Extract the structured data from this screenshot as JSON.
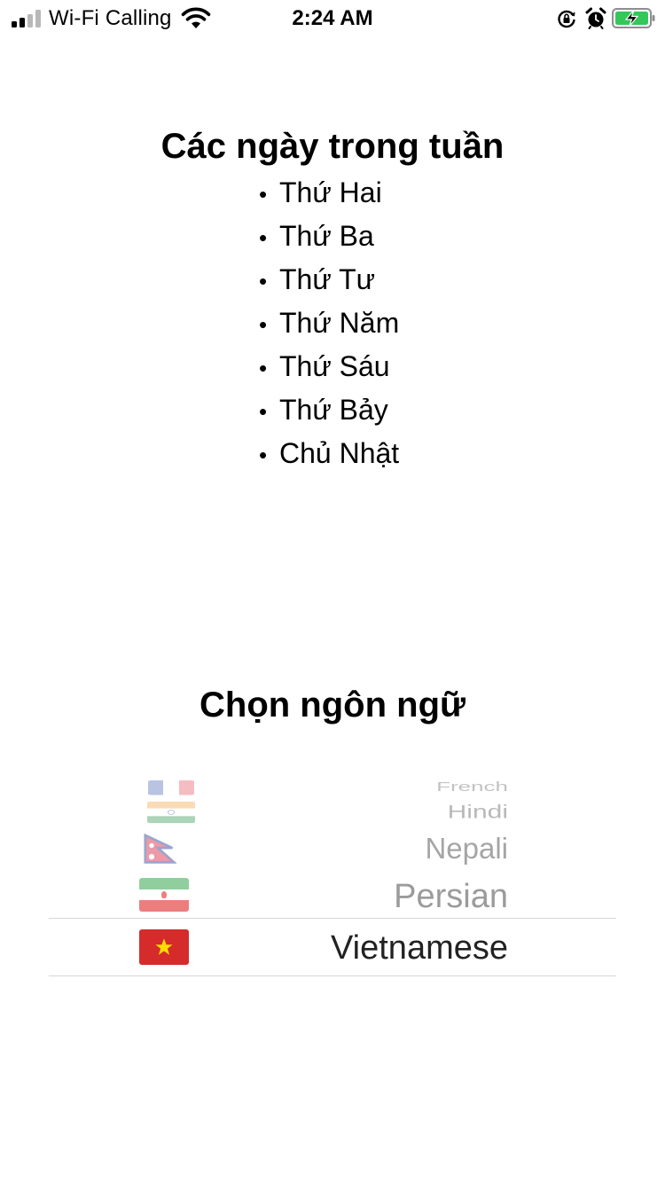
{
  "status_bar": {
    "carrier": "Wi-Fi Calling",
    "time": "2:24 AM",
    "signal_bars_active": 2,
    "signal_bars_total": 4,
    "battery_charging": true,
    "battery_color": "#34c759"
  },
  "weekdays": {
    "title": "Các ngày trong tuần",
    "bullet": "•",
    "items": [
      "Thứ Hai",
      "Thứ Ba",
      "Thứ Tư",
      "Thứ Năm",
      "Thứ Sáu",
      "Thứ Bảy",
      "Chủ Nhật"
    ]
  },
  "language_picker": {
    "title": "Chọn ngôn ngữ",
    "options": [
      {
        "label": "French",
        "flag": "france-flag-icon"
      },
      {
        "label": "Hindi",
        "flag": "india-flag-icon"
      },
      {
        "label": "Nepali",
        "flag": "nepal-flag-icon"
      },
      {
        "label": "Persian",
        "flag": "iran-flag-icon"
      },
      {
        "label": "Vietnamese",
        "flag": "vietnam-flag-icon"
      }
    ],
    "selected": "Vietnamese"
  }
}
